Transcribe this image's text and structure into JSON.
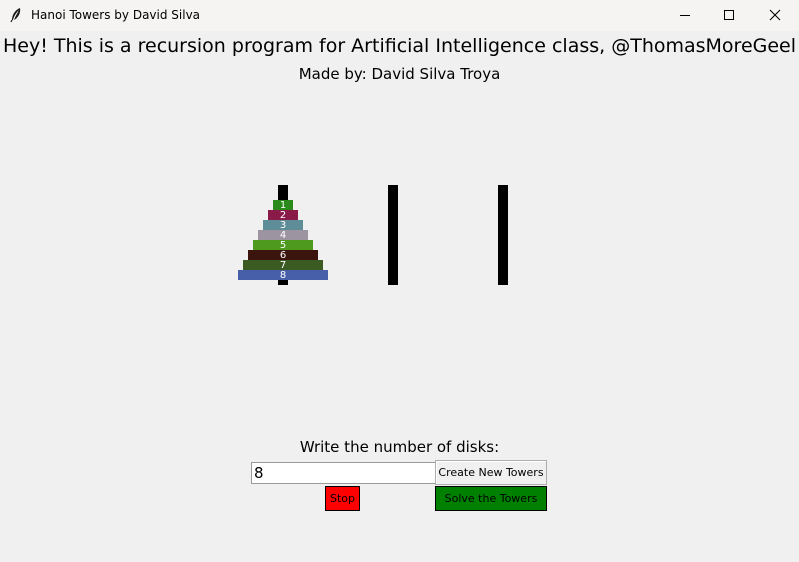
{
  "window": {
    "title": "Hanoi Towers by David Silva",
    "controls": [
      "minimize-icon",
      "maximize-icon",
      "close-icon"
    ],
    "app_icon": "feather-icon"
  },
  "header": {
    "headline": "Hey! This is a recursion program for Artificial Intelligence class, @ThomasMoreGeel",
    "byline": "Made by: David Silva Troya"
  },
  "towers": {
    "peg_color": "#000000",
    "peg_count": 3,
    "disks": [
      {
        "label": "1",
        "color": "#2a8a1c"
      },
      {
        "label": "2",
        "color": "#8a1a48"
      },
      {
        "label": "3",
        "color": "#5e8d97"
      },
      {
        "label": "4",
        "color": "#9d94a2"
      },
      {
        "label": "5",
        "color": "#4e9a1e"
      },
      {
        "label": "6",
        "color": "#3c140e"
      },
      {
        "label": "7",
        "color": "#3b5b23"
      },
      {
        "label": "8",
        "color": "#475ea8"
      }
    ]
  },
  "controls": {
    "prompt": "Write the number of disks:",
    "disk_count_value": "8",
    "create_label": "Create New Towers",
    "stop_label": "Stop",
    "solve_label": "Solve the Towers",
    "stop_color": "#ff0000",
    "solve_color": "#008000"
  }
}
